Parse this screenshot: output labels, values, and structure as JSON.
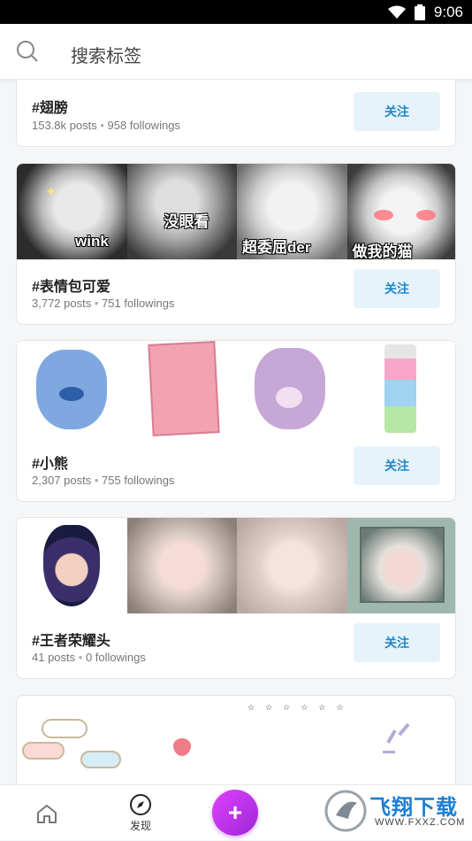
{
  "status": {
    "time": "9:06"
  },
  "search": {
    "placeholder": "搜索标签"
  },
  "cards": [
    {
      "tag": "#翅膀",
      "posts": "153.8k posts",
      "followings": "958 followings",
      "follow_label": "关注"
    },
    {
      "tag": "#表情包可爱",
      "posts": "3,772 posts",
      "followings": "751 followings",
      "follow_label": "关注",
      "captions": [
        "wink",
        "没眼看",
        "超委屈der",
        "做我的猫"
      ]
    },
    {
      "tag": "#小熊",
      "posts": "2,307 posts",
      "followings": "755 followings",
      "follow_label": "关注"
    },
    {
      "tag": "#王者荣耀头",
      "posts": "41 posts",
      "followings": "0 followings",
      "follow_label": "关注"
    }
  ],
  "separator": "•",
  "nav": {
    "discover_label": "发现",
    "add_label": "+"
  },
  "watermark": {
    "brand": "飞翔下载",
    "url": "WWW.FXXZ.COM"
  },
  "colors": {
    "accent": "#1e88c9",
    "fab": "#c03ae8"
  }
}
